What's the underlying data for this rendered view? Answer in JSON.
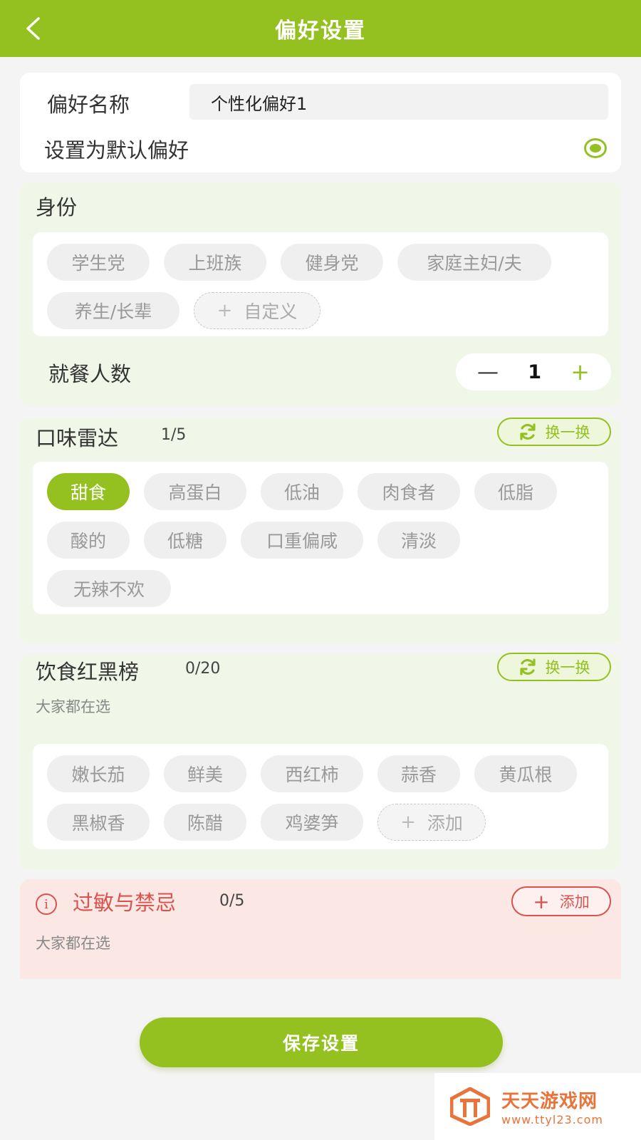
{
  "header": {
    "title": "偏好设置"
  },
  "name_card": {
    "name_label": "偏好名称",
    "name_value": "个性化偏好1",
    "default_label": "设置为默认偏好",
    "default_selected": true
  },
  "identity": {
    "title": "身份",
    "tags": [
      "学生党",
      "上班族",
      "健身党",
      "家庭主妇/夫",
      "养生/长辈"
    ],
    "custom_label": "自定义",
    "diners_label": "就餐人数",
    "diners_value": "1"
  },
  "taste": {
    "title": "口味雷达",
    "counter": "1/5",
    "swap_label": "换一换",
    "tags": [
      "甜食",
      "高蛋白",
      "低油",
      "肉食者",
      "低脂",
      "酸的",
      "低糖",
      "口重偏咸",
      "清淡",
      "无辣不欢"
    ],
    "active_tag": "甜食"
  },
  "diet": {
    "title": "饮食红黑榜",
    "counter": "0/20",
    "subtext": "大家都在选",
    "swap_label": "换一换",
    "tags": [
      "嫩长茄",
      "鲜美",
      "西红柿",
      "蒜香",
      "黄瓜根",
      "黑椒香",
      "陈醋",
      "鸡婆笋"
    ],
    "add_label": "添加"
  },
  "allergy": {
    "title": "过敏与禁忌",
    "counter": "0/5",
    "subtext": "大家都在选",
    "add_label": "添加"
  },
  "footer": {
    "save_label": "保存设置"
  },
  "watermark": {
    "title": "天天游戏网",
    "url": "www.ttyl23.com"
  },
  "colors": {
    "accent": "#94c11f",
    "danger": "#d9534f",
    "watermark": "#e8743b"
  }
}
